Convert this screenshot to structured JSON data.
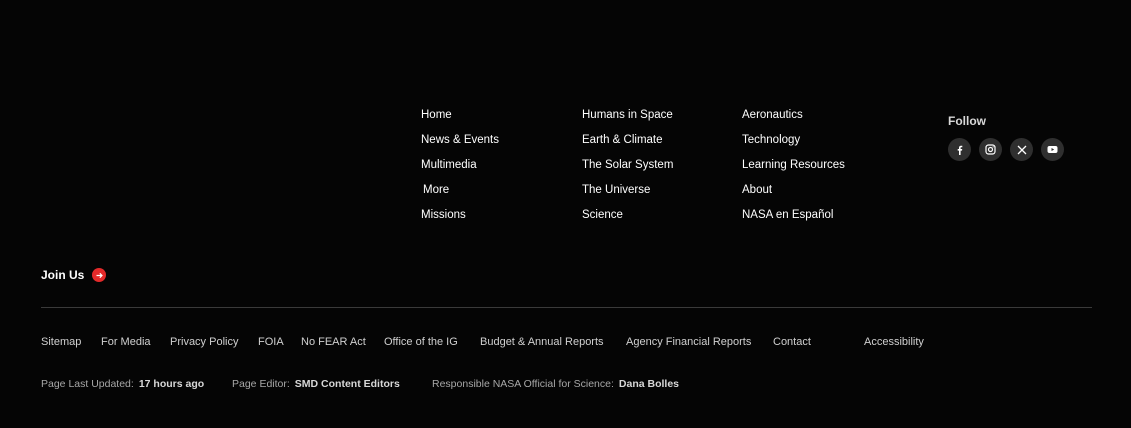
{
  "nav": {
    "col1": [
      "Home",
      "News & Events",
      "Multimedia",
      "More",
      "Missions"
    ],
    "col2": [
      "Humans in Space",
      "Earth & Climate",
      "The Solar System",
      "The Universe",
      "Science"
    ],
    "col3": [
      "Aeronautics",
      "Technology",
      "Learning Resources",
      "About",
      "NASA en Español"
    ]
  },
  "follow": {
    "title": "Follow",
    "icons": [
      "facebook-icon",
      "instagram-icon",
      "x-icon",
      "youtube-icon"
    ]
  },
  "join": {
    "label": "Join Us",
    "icon": "arrow-right-icon",
    "icon_color": "#e42a2a"
  },
  "links": [
    "Sitemap",
    "For Media",
    "Privacy Policy",
    "FOIA",
    "No FEAR Act",
    "Office of the IG",
    "Budget & Annual Reports",
    "Agency Financial Reports",
    "Contact",
    "Accessibility"
  ],
  "meta": {
    "updated_label": "Page Last Updated:",
    "updated_value": "17 hours ago",
    "editor_label": "Page Editor:",
    "editor_value": "SMD Content Editors",
    "official_label": "Responsible NASA Official for Science:",
    "official_value": "Dana Bolles"
  },
  "colors": {
    "background": "#050505",
    "accent": "#e42a2a"
  }
}
